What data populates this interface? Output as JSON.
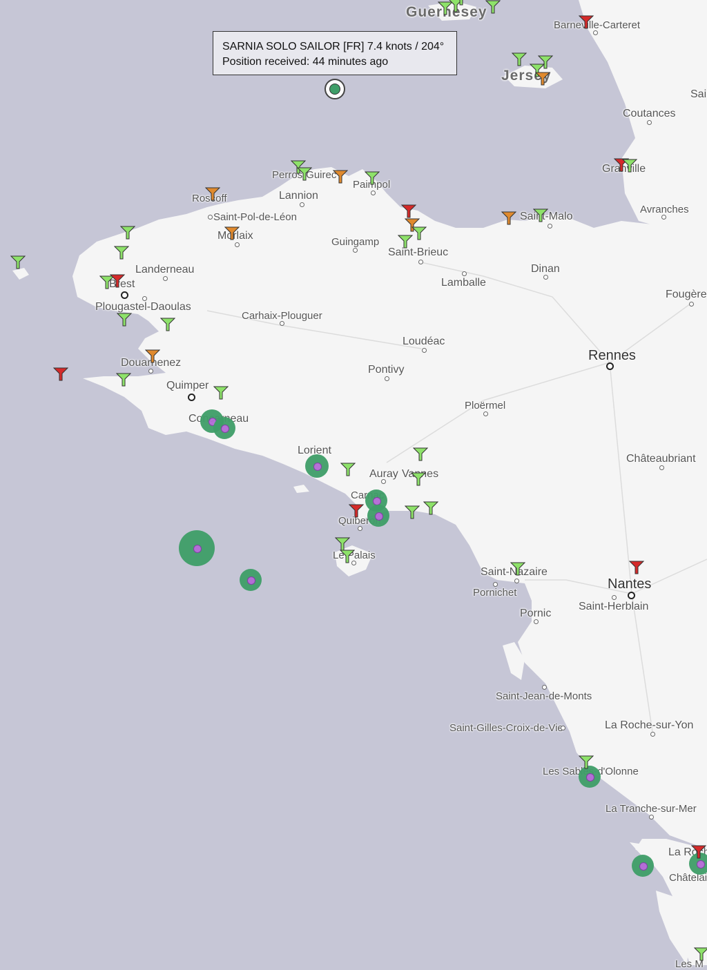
{
  "tooltip": {
    "line1": "SARNIA SOLO SAILOR [FR] 7.4 knots / 204°",
    "line2": "Position received: 44 minutes ago"
  },
  "colors": {
    "sea": "#c6c6d6",
    "land": "#f5f5f5",
    "marker_green": "#8ee26a",
    "marker_orange": "#e08a2e",
    "marker_red": "#d52a2a",
    "boat": "#3f9e68"
  },
  "places": [
    {
      "id": "guernesey",
      "name": "Guernesey"
    },
    {
      "id": "jersey",
      "name": "Jersey"
    },
    {
      "id": "barneville",
      "name": "Barneville-Carteret"
    },
    {
      "id": "coutances",
      "name": "Coutances"
    },
    {
      "id": "granville",
      "name": "Granville"
    },
    {
      "id": "avranches",
      "name": "Avranches"
    },
    {
      "id": "perros",
      "name": "Perros-Guirec"
    },
    {
      "id": "paimpol",
      "name": "Paimpol"
    },
    {
      "id": "lannion",
      "name": "Lannion"
    },
    {
      "id": "roscoff",
      "name": "Roscoff"
    },
    {
      "id": "stpol",
      "name": "Saint-Pol-de-Léon"
    },
    {
      "id": "morlaix",
      "name": "Morlaix"
    },
    {
      "id": "guingamp",
      "name": "Guingamp"
    },
    {
      "id": "stbrieuc",
      "name": "Saint-Brieuc"
    },
    {
      "id": "stmalo",
      "name": "Saint-Malo"
    },
    {
      "id": "dinan",
      "name": "Dinan"
    },
    {
      "id": "lamballe",
      "name": "Lamballe"
    },
    {
      "id": "landerneau",
      "name": "Landerneau"
    },
    {
      "id": "brest",
      "name": "Brest"
    },
    {
      "id": "plougastel",
      "name": "Plougastel-Daoulas"
    },
    {
      "id": "carhaix",
      "name": "Carhaix-Plouguer"
    },
    {
      "id": "loudeac",
      "name": "Loudéac"
    },
    {
      "id": "fougeres",
      "name": "Fougères"
    },
    {
      "id": "rennes",
      "name": "Rennes"
    },
    {
      "id": "douarnenez",
      "name": "Douarnenez"
    },
    {
      "id": "pontivy",
      "name": "Pontivy"
    },
    {
      "id": "quimper",
      "name": "Quimper"
    },
    {
      "id": "concarneau",
      "name": "Concarneau"
    },
    {
      "id": "ploermel",
      "name": "Ploërmel"
    },
    {
      "id": "lorient",
      "name": "Lorient"
    },
    {
      "id": "chateaubriant",
      "name": "Châteaubriant"
    },
    {
      "id": "auray",
      "name": "Auray"
    },
    {
      "id": "vannes",
      "name": "Vannes"
    },
    {
      "id": "carnac",
      "name": "Carnac"
    },
    {
      "id": "quiberon",
      "name": "Quiberon"
    },
    {
      "id": "lepalais",
      "name": "Le Palais"
    },
    {
      "id": "stnazaire",
      "name": "Saint-Nazaire"
    },
    {
      "id": "pornichet",
      "name": "Pornichet"
    },
    {
      "id": "nantes",
      "name": "Nantes"
    },
    {
      "id": "stherblain",
      "name": "Saint-Herblain"
    },
    {
      "id": "pornic",
      "name": "Pornic"
    },
    {
      "id": "stjean",
      "name": "Saint-Jean-de-Monts"
    },
    {
      "id": "stgilles",
      "name": "Saint-Gilles-Croix-de-Vie"
    },
    {
      "id": "larochesuryon",
      "name": "La Roche-sur-Yon"
    },
    {
      "id": "lessables",
      "name": "Les Sables-d'Olonne"
    },
    {
      "id": "latranche",
      "name": "La Tranche-sur-Mer"
    },
    {
      "id": "larochelle",
      "name": "La Rochelle"
    },
    {
      "id": "chatelaillon",
      "name": "Châtelaillon"
    },
    {
      "id": "sai",
      "name": "Saint-Lô"
    },
    {
      "id": "lesm",
      "name": "Les M"
    }
  ]
}
